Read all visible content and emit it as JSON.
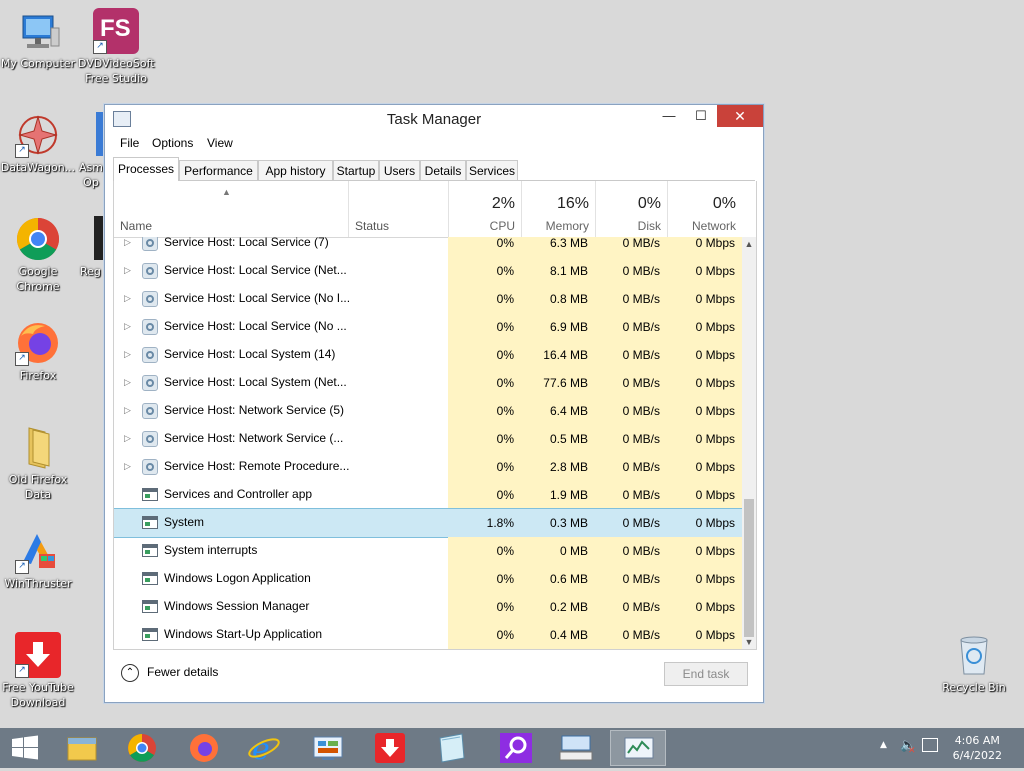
{
  "desktop": {
    "icons": [
      {
        "label": "My Computer",
        "icon": "computer-icon"
      },
      {
        "label": "DVDVideoSoft\nFree Studio",
        "icon": "fs-icon",
        "badge": "FS"
      },
      {
        "label": "DataWagon...",
        "icon": "datawagon-icon"
      },
      {
        "label": "Asm\nOp",
        "icon": "app-icon"
      },
      {
        "label": "Google\nChrome",
        "icon": "chrome-icon"
      },
      {
        "label": "Reg",
        "icon": "app-icon"
      },
      {
        "label": "Firefox",
        "icon": "firefox-icon"
      },
      {
        "label": "Old Firefox\nData",
        "icon": "folder-icon"
      },
      {
        "label": "WinThruster",
        "icon": "winthruster-icon"
      },
      {
        "label": "Free YouTube\nDownload",
        "icon": "download-icon"
      },
      {
        "label": "Recycle Bin",
        "icon": "recycle-bin-icon"
      }
    ]
  },
  "window": {
    "title": "Task Manager",
    "minimize": "—",
    "maximize": "☐",
    "close": "✕"
  },
  "menu": {
    "file": "File",
    "options": "Options",
    "view": "View"
  },
  "tabs": [
    "Processes",
    "Performance",
    "App history",
    "Startup",
    "Users",
    "Details",
    "Services"
  ],
  "columns": {
    "name": "Name",
    "status": "Status",
    "cpu": {
      "pct": "2%",
      "label": "CPU"
    },
    "memory": {
      "pct": "16%",
      "label": "Memory"
    },
    "disk": {
      "pct": "0%",
      "label": "Disk"
    },
    "network": {
      "pct": "0%",
      "label": "Network"
    }
  },
  "processes": [
    {
      "name": "Service Host: Local Service (7)",
      "cpu": "0%",
      "memory": "6.3 MB",
      "disk": "0 MB/s",
      "network": "0 Mbps",
      "icon": "gear",
      "expand": true
    },
    {
      "name": "Service Host: Local Service (Net...",
      "cpu": "0%",
      "memory": "8.1 MB",
      "disk": "0 MB/s",
      "network": "0 Mbps",
      "icon": "gear",
      "expand": true
    },
    {
      "name": "Service Host: Local Service (No I...",
      "cpu": "0%",
      "memory": "0.8 MB",
      "disk": "0 MB/s",
      "network": "0 Mbps",
      "icon": "gear",
      "expand": true
    },
    {
      "name": "Service Host: Local Service (No ...",
      "cpu": "0%",
      "memory": "6.9 MB",
      "disk": "0 MB/s",
      "network": "0 Mbps",
      "icon": "gear",
      "expand": true
    },
    {
      "name": "Service Host: Local System (14)",
      "cpu": "0%",
      "memory": "16.4 MB",
      "disk": "0 MB/s",
      "network": "0 Mbps",
      "icon": "gear",
      "expand": true
    },
    {
      "name": "Service Host: Local System (Net...",
      "cpu": "0%",
      "memory": "77.6 MB",
      "disk": "0 MB/s",
      "network": "0 Mbps",
      "icon": "gear",
      "expand": true
    },
    {
      "name": "Service Host: Network Service (5)",
      "cpu": "0%",
      "memory": "6.4 MB",
      "disk": "0 MB/s",
      "network": "0 Mbps",
      "icon": "gear",
      "expand": true
    },
    {
      "name": "Service Host: Network Service (...",
      "cpu": "0%",
      "memory": "0.5 MB",
      "disk": "0 MB/s",
      "network": "0 Mbps",
      "icon": "gear",
      "expand": true
    },
    {
      "name": "Service Host: Remote Procedure...",
      "cpu": "0%",
      "memory": "2.8 MB",
      "disk": "0 MB/s",
      "network": "0 Mbps",
      "icon": "gear",
      "expand": true
    },
    {
      "name": "Services and Controller app",
      "cpu": "0%",
      "memory": "1.9 MB",
      "disk": "0 MB/s",
      "network": "0 Mbps",
      "icon": "app",
      "expand": false
    },
    {
      "name": "System",
      "cpu": "1.8%",
      "memory": "0.3 MB",
      "disk": "0 MB/s",
      "network": "0 Mbps",
      "icon": "app",
      "expand": false,
      "selected": true
    },
    {
      "name": "System interrupts",
      "cpu": "0%",
      "memory": "0 MB",
      "disk": "0 MB/s",
      "network": "0 Mbps",
      "icon": "app",
      "expand": false
    },
    {
      "name": "Windows Logon Application",
      "cpu": "0%",
      "memory": "0.6 MB",
      "disk": "0 MB/s",
      "network": "0 Mbps",
      "icon": "app",
      "expand": false
    },
    {
      "name": "Windows Session Manager",
      "cpu": "0%",
      "memory": "0.2 MB",
      "disk": "0 MB/s",
      "network": "0 Mbps",
      "icon": "app",
      "expand": false
    },
    {
      "name": "Windows Start-Up Application",
      "cpu": "0%",
      "memory": "0.4 MB",
      "disk": "0 MB/s",
      "network": "0 Mbps",
      "icon": "app",
      "expand": false
    }
  ],
  "footer": {
    "fewer_details": "Fewer details",
    "end_task": "End task"
  },
  "taskbar": {
    "items": [
      "start-icon",
      "file-explorer-icon",
      "chrome-icon",
      "firefox-icon",
      "internet-explorer-icon",
      "control-panel-icon",
      "youtube-download-icon",
      "notepad-icon",
      "search-app-icon",
      "keyboard-icon",
      "task-manager-icon"
    ],
    "time": "4:06 AM",
    "date": "6/4/2022"
  }
}
